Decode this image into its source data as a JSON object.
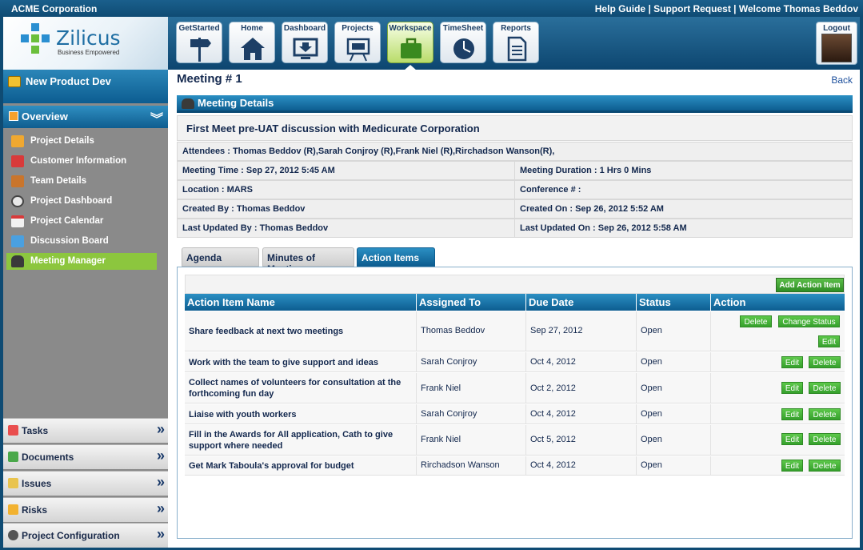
{
  "topbar": {
    "company": "ACME Corporation",
    "help": "Help Guide",
    "support": "Support Request",
    "welcome": "Welcome Thomas Beddov",
    "sep": " | "
  },
  "logo": {
    "name": "Zilicus",
    "tagline": "Business Empowered"
  },
  "nav": [
    {
      "label": "GetStarted",
      "icon": "signpost-icon"
    },
    {
      "label": "Home",
      "icon": "home-icon"
    },
    {
      "label": "Dashboard",
      "icon": "dashboard-monitor-icon"
    },
    {
      "label": "Projects",
      "icon": "projects-board-icon"
    },
    {
      "label": "Workspace",
      "icon": "briefcase-icon",
      "active": true
    },
    {
      "label": "TimeSheet",
      "icon": "clock-icon"
    },
    {
      "label": "Reports",
      "icon": "report-document-icon"
    }
  ],
  "logout": "Logout",
  "sidebar": {
    "project": "New Product Dev",
    "overview": "Overview",
    "items": [
      {
        "label": "Project Details",
        "icon": "project-details-icon"
      },
      {
        "label": "Customer Information",
        "icon": "customer-icon"
      },
      {
        "label": "Team Details",
        "icon": "team-icon"
      },
      {
        "label": "Project Dashboard",
        "icon": "dashboard-gauge-icon"
      },
      {
        "label": "Project Calendar",
        "icon": "calendar-icon"
      },
      {
        "label": "Discussion Board",
        "icon": "discussion-icon"
      },
      {
        "label": "Meeting Manager",
        "icon": "meeting-icon",
        "active": true
      }
    ],
    "sections": [
      {
        "label": "Tasks",
        "icon": "tasks-icon"
      },
      {
        "label": "Documents",
        "icon": "documents-icon"
      },
      {
        "label": "Issues",
        "icon": "issues-icon"
      },
      {
        "label": "Risks",
        "icon": "risks-icon"
      },
      {
        "label": "Project Configuration",
        "icon": "gear-icon"
      }
    ]
  },
  "main": {
    "title": "Meeting # 1",
    "back": "Back",
    "details_header": "Meeting Details",
    "meeting_title": "First Meet pre-UAT discussion with Medicurate Corporation",
    "attendees": "Attendees : Thomas Beddov (R),Sarah Conjroy (R),Frank Niel (R),Rirchadson Wanson(R),",
    "meeting_time": "Meeting Time : Sep 27, 2012 5:45 AM",
    "meeting_duration": "Meeting Duration : 1 Hrs 0 Mins",
    "location": "Location : MARS",
    "conference": "Conference # :",
    "created_by": "Created By : Thomas Beddov",
    "created_on": "Created On : Sep 26, 2012 5:52 AM",
    "updated_by": "Last Updated By : Thomas Beddov",
    "updated_on": "Last Updated On : Sep 26, 2012 5:58 AM"
  },
  "tabs": [
    "Agenda",
    "Minutes of Meeting",
    "Action Items"
  ],
  "action": {
    "add_label": "Add Action Item",
    "headers": [
      "Action Item Name",
      "Assigned To",
      "Due Date",
      "Status",
      "Action"
    ],
    "btn_delete": "Delete",
    "btn_change_status": "Change Status",
    "btn_edit": "Edit",
    "rows": [
      {
        "name": "Share feedback at next two meetings",
        "assigned": "Thomas Beddov",
        "due": "Sep 27, 2012",
        "status": "Open"
      },
      {
        "name": "Work with the team to give support and ideas",
        "assigned": "Sarah Conjroy",
        "due": "Oct 4, 2012",
        "status": "Open"
      },
      {
        "name": "Collect names of volunteers for consultation at the forthcoming fun day",
        "assigned": "Frank Niel",
        "due": "Oct 2, 2012",
        "status": "Open"
      },
      {
        "name": "Liaise with youth workers",
        "assigned": "Sarah Conjroy",
        "due": "Oct 4, 2012",
        "status": "Open"
      },
      {
        "name": "Fill in the Awards for All application, Cath to give support where needed",
        "assigned": "Frank Niel",
        "due": "Oct 5, 2012",
        "status": "Open"
      },
      {
        "name": "Get Mark Taboula's approval for budget",
        "assigned": "Rirchadson Wanson",
        "due": "Oct 4, 2012",
        "status": "Open"
      }
    ]
  }
}
